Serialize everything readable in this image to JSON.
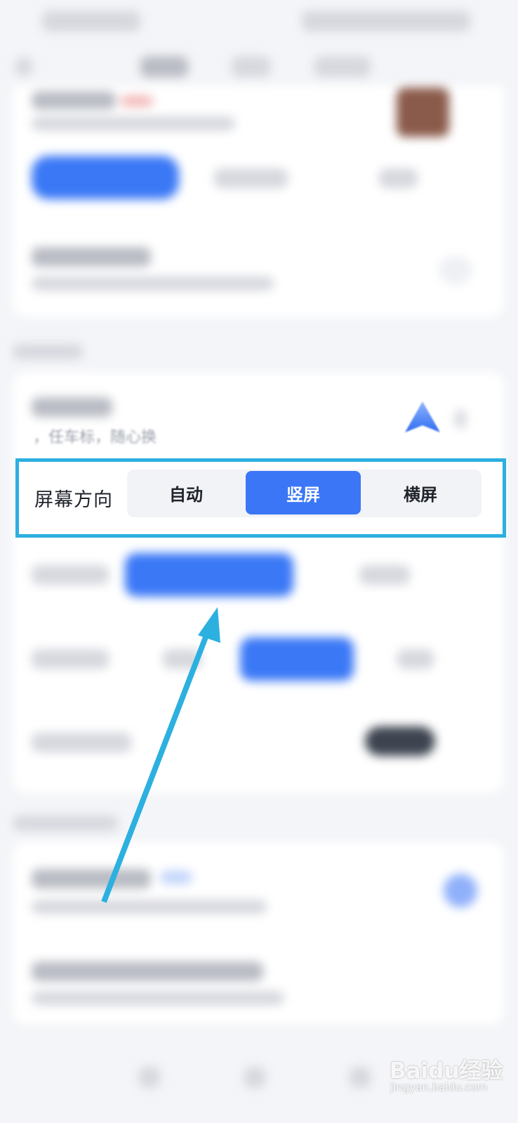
{
  "orientation_setting": {
    "label": "屏幕方向",
    "options": [
      "自动",
      "竖屏",
      "横屏"
    ],
    "selected": "竖屏"
  },
  "partial_visible_text": "，任车标，随心换",
  "watermark": {
    "text": "Baidu经验",
    "sub": "jingyan.baidu.com"
  },
  "colors": {
    "accent": "#3b76f6",
    "highlight_border": "#2cb0e0",
    "arrow": "#2cb0e0"
  },
  "icons": {
    "car_marker": "navigation-arrow-icon"
  }
}
